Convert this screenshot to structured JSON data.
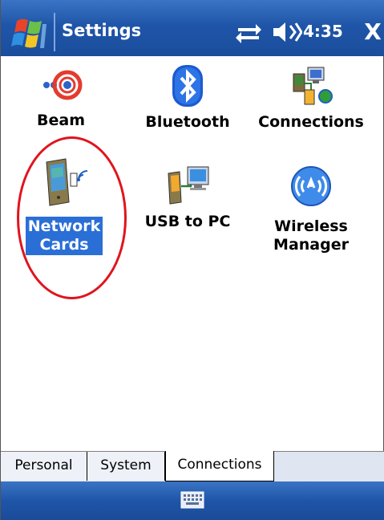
{
  "window": {
    "title": "Settings",
    "clock": "4:35",
    "close_label": "X"
  },
  "items": [
    {
      "label": "Beam",
      "icon": "beam-icon"
    },
    {
      "label": "Bluetooth",
      "icon": "bluetooth-icon"
    },
    {
      "label": "Connections",
      "icon": "connections-icon"
    },
    {
      "label_line1": "Network",
      "label_line2": "Cards",
      "icon": "network-cards-icon",
      "selected": true
    },
    {
      "label": "USB to PC",
      "icon": "usb-to-pc-icon"
    },
    {
      "label_line1": "Wireless",
      "label_line2": "Manager",
      "icon": "wireless-manager-icon"
    }
  ],
  "tabs": [
    {
      "label": "Personal"
    },
    {
      "label": "System"
    },
    {
      "label": "Connections",
      "active": true
    }
  ],
  "colors": {
    "titlebar": "#1f55a8",
    "selection": "#2a6fd6",
    "annotation_circle": "#e0141d"
  }
}
